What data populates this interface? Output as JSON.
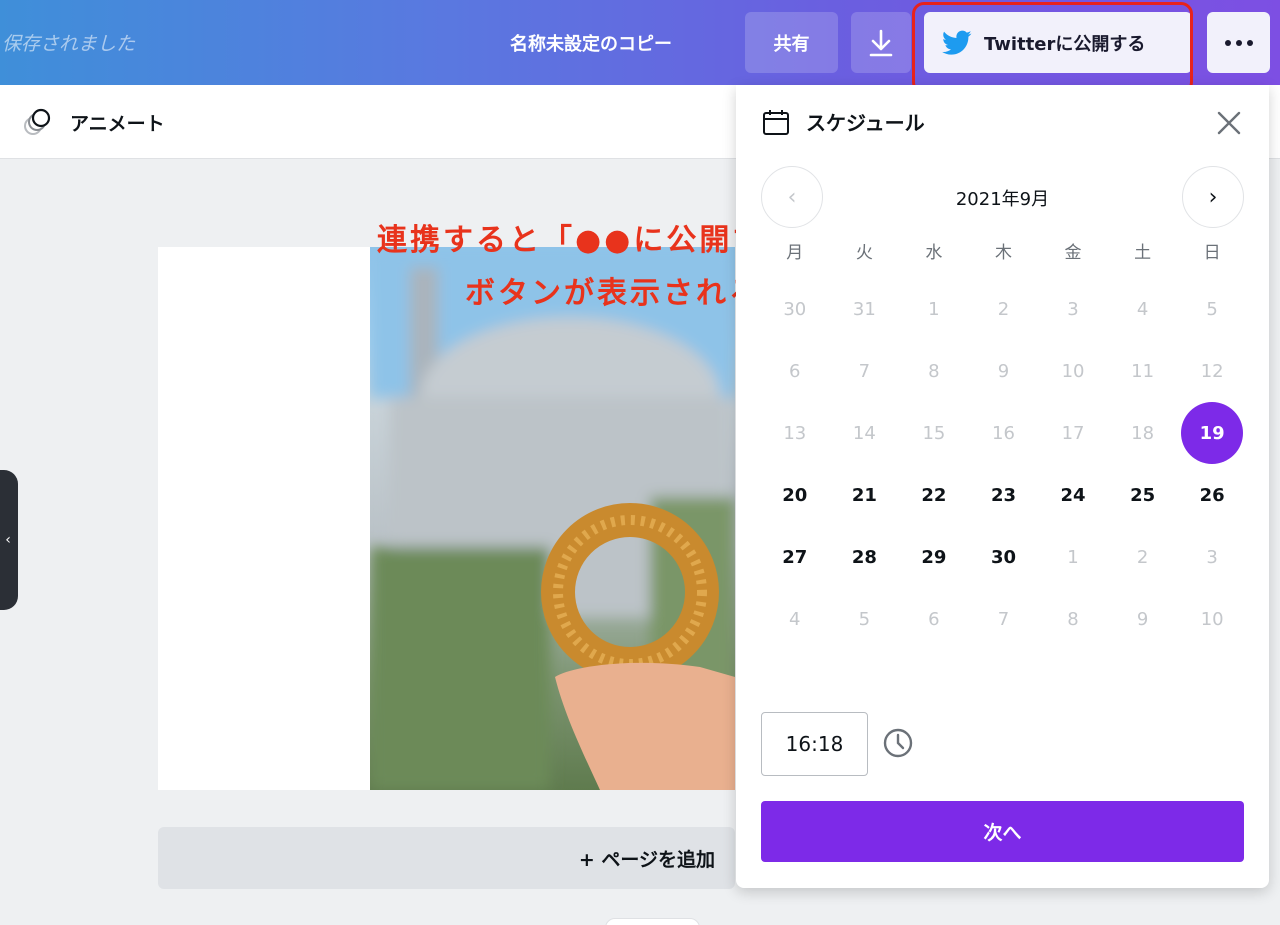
{
  "topbar": {
    "saved_status": "保存されました",
    "doc_title": "名称未設定のコピー",
    "share_label": "共有",
    "publish_label": "Twitterに公開する",
    "download_icon": "download-icon",
    "more_icon": "more-icon"
  },
  "subbar": {
    "animate_label": "アニメート"
  },
  "canvas": {
    "add_page_label": "+ ページを追加"
  },
  "annotation": {
    "line1": "連携すると「●●に公開する」",
    "line2": "ボタンが表示される"
  },
  "schedule": {
    "title": "スケジュール",
    "month": "2021年9月",
    "weekdays": [
      "月",
      "火",
      "水",
      "木",
      "金",
      "土",
      "日"
    ],
    "weeks": [
      [
        "30",
        "31",
        "1",
        "2",
        "3",
        "4",
        "5"
      ],
      [
        "6",
        "7",
        "8",
        "9",
        "10",
        "11",
        "12"
      ],
      [
        "13",
        "14",
        "15",
        "16",
        "17",
        "18",
        "19"
      ],
      [
        "20",
        "21",
        "22",
        "23",
        "24",
        "25",
        "26"
      ],
      [
        "27",
        "28",
        "29",
        "30",
        "1",
        "2",
        "3"
      ],
      [
        "4",
        "5",
        "6",
        "7",
        "8",
        "9",
        "10"
      ]
    ],
    "selected_day": "19",
    "time": "16:18",
    "next_label": "次へ"
  },
  "colors": {
    "accent": "#7d2ae8",
    "annotation_red": "#e8331c",
    "twitter_blue": "#1d9bf0"
  }
}
